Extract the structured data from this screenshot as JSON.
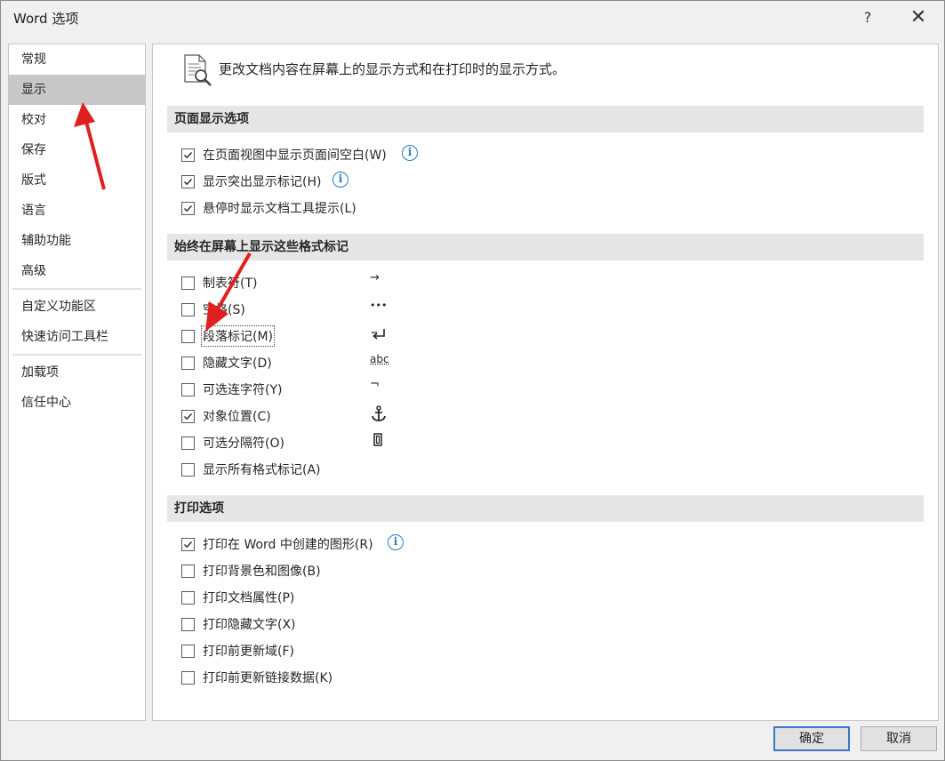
{
  "window": {
    "title": "Word 选项",
    "help_label": "?",
    "close_label": "✕"
  },
  "nav": {
    "items": [
      {
        "label": "常规"
      },
      {
        "label": "显示",
        "selected": true
      },
      {
        "label": "校对"
      },
      {
        "label": "保存"
      },
      {
        "label": "版式"
      },
      {
        "label": "语言"
      },
      {
        "label": "辅助功能"
      },
      {
        "label": "高级"
      },
      {
        "label": "自定义功能区"
      },
      {
        "label": "快速访问工具栏"
      },
      {
        "label": "加载项"
      },
      {
        "label": "信任中心"
      }
    ]
  },
  "main": {
    "header_text": "更改文档内容在屏幕上的显示方式和在打印时的显示方式。",
    "header_icon": "document-magnifier-icon",
    "sections": {
      "page_display": {
        "title": "页面显示选项",
        "options": [
          {
            "label": "在页面视图中显示页面间空白(W)",
            "checked": true,
            "info": true
          },
          {
            "label": "显示突出显示标记(H)",
            "checked": true,
            "info": true
          },
          {
            "label": "悬停时显示文档工具提示(L)",
            "checked": true,
            "info": false
          }
        ]
      },
      "format_marks": {
        "title": "始终在屏幕上显示这些格式标记",
        "options": [
          {
            "label": "制表符(T)",
            "checked": false,
            "mark": "→"
          },
          {
            "label": "空格(S)",
            "checked": false,
            "mark": "•••"
          },
          {
            "label": "段落标记(M)",
            "checked": false,
            "mark": "paragraph-mark-icon"
          },
          {
            "label": "隐藏文字(D)",
            "checked": false,
            "mark": "abc"
          },
          {
            "label": "可选连字符(Y)",
            "checked": false,
            "mark": "¬"
          },
          {
            "label": "对象位置(C)",
            "checked": true,
            "mark": "anchor-icon"
          },
          {
            "label": "可选分隔符(O)",
            "checked": false,
            "mark": "optional-break-icon"
          },
          {
            "label": "显示所有格式标记(A)",
            "checked": false
          }
        ]
      },
      "print": {
        "title": "打印选项",
        "options": [
          {
            "label": "打印在 Word 中创建的图形(R)",
            "checked": true,
            "info": true
          },
          {
            "label": "打印背景色和图像(B)",
            "checked": false
          },
          {
            "label": "打印文档属性(P)",
            "checked": false
          },
          {
            "label": "打印隐藏文字(X)",
            "checked": false
          },
          {
            "label": "打印前更新域(F)",
            "checked": false
          },
          {
            "label": "打印前更新链接数据(K)",
            "checked": false
          }
        ]
      }
    }
  },
  "buttons": {
    "ok_label": "确定",
    "cancel_label": "取消"
  },
  "colors": {
    "selected_nav": "#c8c8c8",
    "section_header_bg": "#e6e6e6",
    "info_blue": "#2b79c2",
    "annotation_red": "#e02020"
  }
}
